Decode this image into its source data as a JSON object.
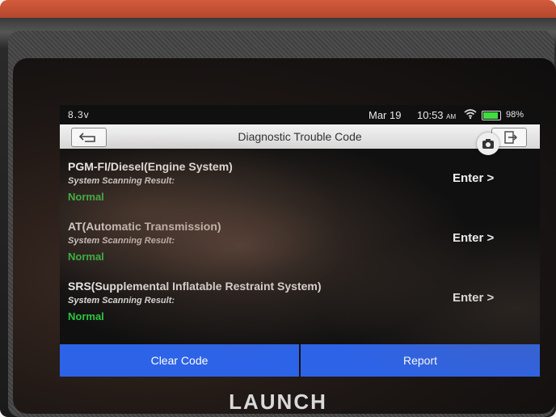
{
  "status_bar": {
    "left_text": "8.3v",
    "date": "Mar 19",
    "time": "10:53",
    "time_suffix": "AM",
    "battery_percent": "98%",
    "battery_level": 0.98
  },
  "title_bar": {
    "title": "Diagnostic Trouble Code",
    "back_icon": "back-arrow-icon",
    "exit_icon": "exit-icon",
    "camera_icon": "camera-icon"
  },
  "systems": [
    {
      "name": "PGM-FI/Diesel(Engine System)",
      "result_label": "System Scanning Result:",
      "result_value": "Normal",
      "action": "Enter >"
    },
    {
      "name": "AT(Automatic Transmission)",
      "result_label": "System Scanning Result:",
      "result_value": "Normal",
      "action": "Enter >"
    },
    {
      "name": "SRS(Supplemental Inflatable Restraint System)",
      "result_label": "System Scanning Result:",
      "result_value": "Normal",
      "action": "Enter >"
    }
  ],
  "bottom_bar": {
    "clear_label": "Clear Code",
    "report_label": "Report"
  },
  "brand": "LAUNCH",
  "colors": {
    "accent_blue": "#2d63e6",
    "normal_green": "#27c93f",
    "case_orange": "#c9573a"
  }
}
